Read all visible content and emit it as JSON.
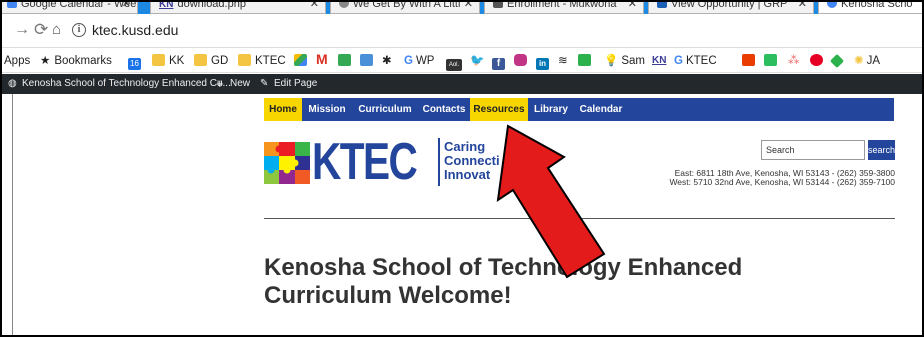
{
  "browser": {
    "tabs": [
      {
        "label": "Google Calendar - Wee",
        "color": "#4285f4"
      },
      {
        "label": "download.php",
        "prefix": "KN",
        "color": "#3b3b98"
      },
      {
        "label": "We Get By With A Littl",
        "color": "#888888"
      },
      {
        "label": "Enrollment - Mukwona",
        "color": "#555555"
      },
      {
        "label": "View Opportunity | GRP",
        "color": "#1a5fb4"
      },
      {
        "label": "Kenosha Scho",
        "color": "#4285f4"
      }
    ],
    "url": "ktec.kusd.edu",
    "bookmarks": [
      {
        "label": "Apps",
        "icon": "apps-icon"
      },
      {
        "label": "Bookmarks",
        "icon": "star-icon"
      },
      {
        "label": "",
        "icon": "calendar-icon",
        "text": "16"
      },
      {
        "label": "KK",
        "icon": "folder-icon"
      },
      {
        "label": "GD",
        "icon": "folder-icon"
      },
      {
        "label": "KTEC",
        "icon": "folder-icon"
      },
      {
        "label": "",
        "icon": "drive-icon"
      },
      {
        "label": "",
        "icon": "gmail-icon"
      },
      {
        "label": "",
        "icon": "classroom-icon"
      },
      {
        "label": "",
        "icon": "slides-icon"
      },
      {
        "label": "",
        "icon": "puzzle-icon"
      },
      {
        "label": "WP",
        "icon": "google-icon"
      },
      {
        "label": "",
        "icon": "aol-icon",
        "text": "Aol."
      },
      {
        "label": "",
        "icon": "twitter-icon"
      },
      {
        "label": "",
        "icon": "facebook-icon"
      },
      {
        "label": "",
        "icon": "instagram-icon"
      },
      {
        "label": "",
        "icon": "linkedin-icon"
      },
      {
        "label": "",
        "icon": "stack-icon"
      },
      {
        "label": "",
        "icon": "green-icon"
      },
      {
        "label": "Sam",
        "icon": "bulb-icon"
      },
      {
        "label": "",
        "icon": "kn-icon",
        "text": "KN"
      },
      {
        "label": "KTEC",
        "icon": "google-icon"
      },
      {
        "label": "",
        "icon": "office-icon"
      },
      {
        "label": "",
        "icon": "evernote-icon"
      },
      {
        "label": "",
        "icon": "asana-icon"
      },
      {
        "label": "",
        "icon": "pinterest-icon"
      },
      {
        "label": "",
        "icon": "feedly-icon"
      },
      {
        "label": "JA",
        "icon": "sun-icon"
      }
    ]
  },
  "adminbar": {
    "site_name": "Kenosha School of Technology Enhanced Cu...",
    "new_label": "New",
    "edit_label": "Edit Page"
  },
  "site": {
    "nav": [
      "Home",
      "Mission",
      "Curriculum",
      "Contacts",
      "Resources",
      "Library",
      "Calendar"
    ],
    "logo_text": "KTEC",
    "tagline": [
      "Caring",
      "Connecti",
      "Innovat"
    ],
    "search_placeholder": "Search",
    "search_button": "search",
    "address_east": "East: 6811 18th Ave, Kenosha, WI 53143 - (262) 359-3800",
    "address_west": "West: 5710 32nd Ave, Kenosha, WI 53144 - (262) 359-7100",
    "heading": "Kenosha School of Technology Enhanced Curriculum Welcome!"
  },
  "colors": {
    "brand_blue": "#23459b",
    "highlight_yellow": "#f7d600",
    "arrow_red": "#e31b1b"
  }
}
